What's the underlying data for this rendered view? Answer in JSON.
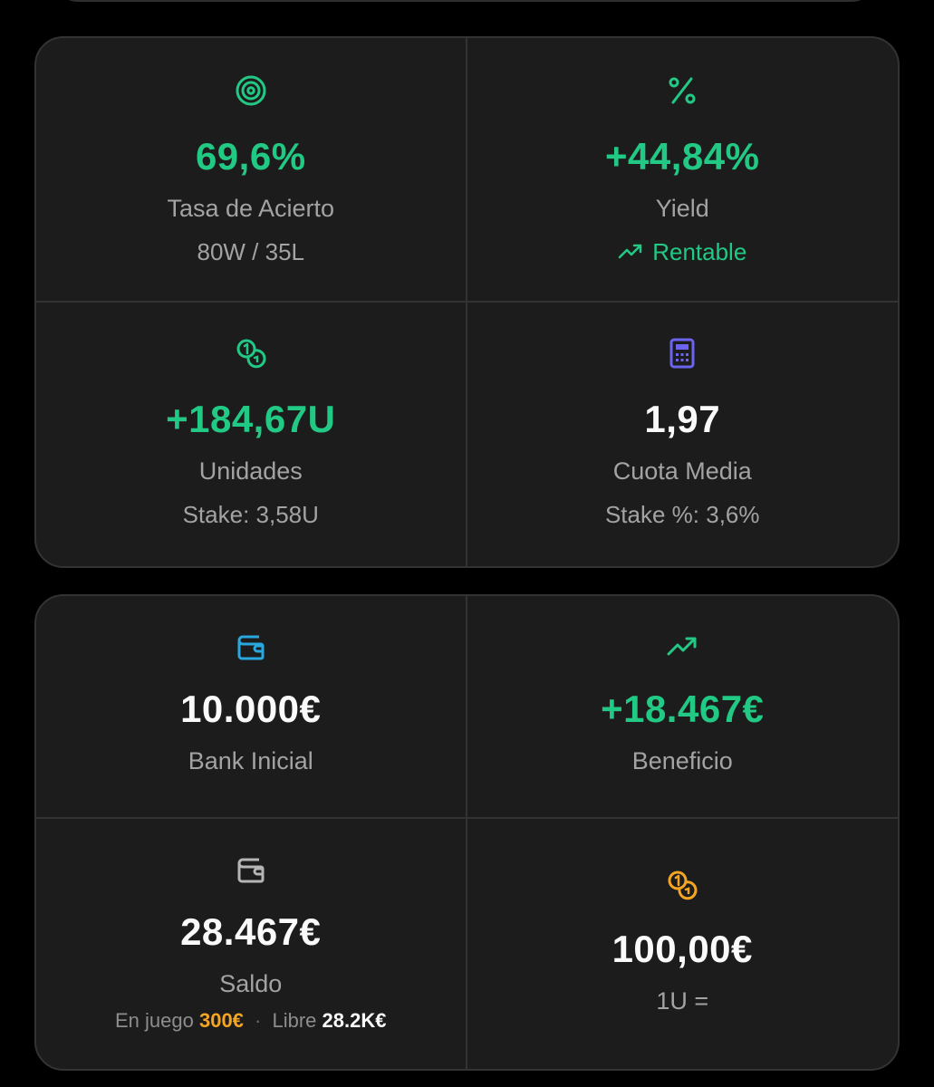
{
  "colors": {
    "green": "#22c985",
    "indigo": "#6b64f0",
    "blue": "#29a8e0",
    "orange": "#f5a524",
    "grey_icon": "#b5b5b5"
  },
  "stats": {
    "hit_rate": {
      "icon": "target-icon",
      "value": "69,6%",
      "label": "Tasa de Acierto",
      "sub": "80W / 35L"
    },
    "yield": {
      "icon": "percent-icon",
      "value": "+44,84%",
      "label": "Yield",
      "sub": "Rentable",
      "sub_icon": "trending-up-icon"
    },
    "units": {
      "icon": "coins-icon",
      "value": "+184,67U",
      "label": "Unidades",
      "sub": "Stake: 3,58U"
    },
    "avg_odds": {
      "icon": "calculator-icon",
      "value": "1,97",
      "label": "Cuota Media",
      "sub": "Stake %: 3,6%"
    }
  },
  "bank": {
    "initial": {
      "icon": "wallet-icon",
      "value": "10.000€",
      "label": "Bank Inicial"
    },
    "profit": {
      "icon": "trending-up-icon",
      "value": "+18.467€",
      "label": "Beneficio"
    },
    "balance": {
      "icon": "wallet-icon",
      "value": "28.467€",
      "label": "Saldo",
      "in_play_label": "En juego",
      "in_play_value": "300€",
      "free_label": "Libre",
      "free_value": "28.2K€",
      "separator": "·"
    },
    "unit_value": {
      "icon": "coins-icon",
      "value": "100,00€",
      "label": "1U ="
    }
  }
}
